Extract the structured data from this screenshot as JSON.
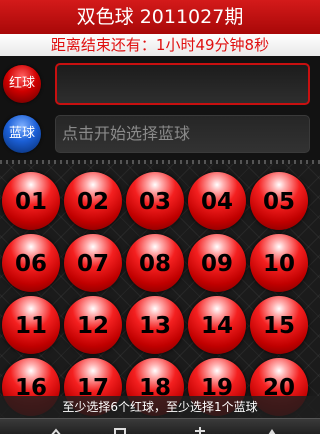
{
  "header": {
    "title": "双色球 2011027期"
  },
  "countdown": {
    "text": "距离结束还有：1小时49分钟8秒"
  },
  "red_row": {
    "badge_label": "红球",
    "value": ""
  },
  "blue_row": {
    "badge_label": "蓝球",
    "placeholder": "点击开始选择蓝球"
  },
  "balls": [
    "01",
    "02",
    "03",
    "04",
    "05",
    "06",
    "07",
    "08",
    "09",
    "10",
    "11",
    "12",
    "13",
    "14",
    "15",
    "16",
    "17",
    "18",
    "19",
    "20"
  ],
  "hint": "至少选择6个红球，至少选择1个蓝球",
  "colors": {
    "title_red": "#c81010",
    "countdown_text": "#e01010",
    "ball_red": "#f42020",
    "badge_blue": "#1b5fd6"
  },
  "bottom_icons": [
    "up-arrow-icon",
    "square-icon",
    "sparkle-icon",
    "triangle-icon"
  ]
}
